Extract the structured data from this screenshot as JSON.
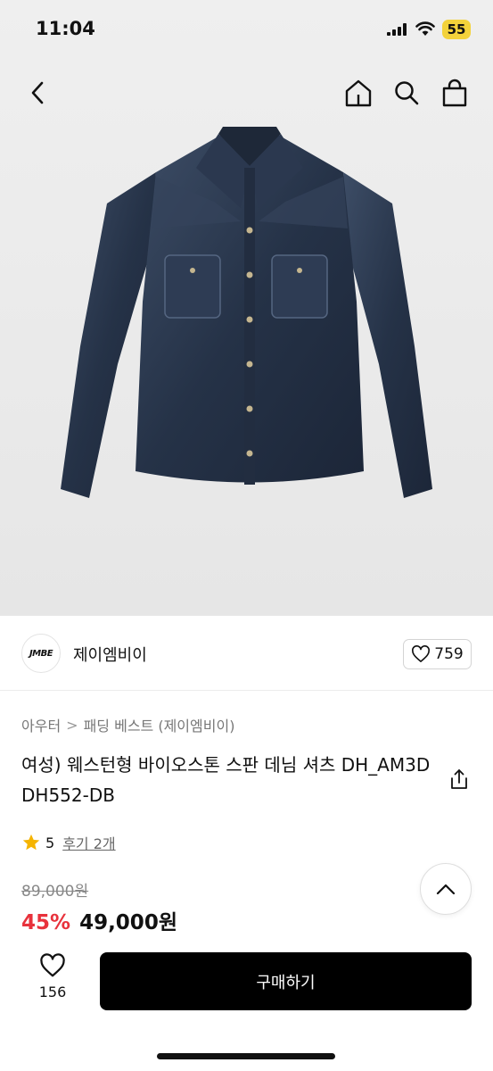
{
  "status_bar": {
    "time": "11:04",
    "battery": "55",
    "icons": [
      "signal-icon",
      "wifi-icon",
      "battery-icon"
    ]
  },
  "nav": {
    "icons": [
      "back-icon",
      "home-icon",
      "search-icon",
      "cart-icon"
    ]
  },
  "product_image": {
    "description_icon": "denim-shirt-image"
  },
  "brand": {
    "logo_text": "JMBE",
    "name": "제이엠비이",
    "likes": "759"
  },
  "breadcrumb": {
    "category": "아우터",
    "separator": ">",
    "subcategory": "패딩 베스트 (제이엠비이)"
  },
  "product": {
    "title": "여성) 웨스턴형 바이오스톤 스판 데님 셔츠 DH_AM3DDH552-DB",
    "rating": "5",
    "review_link": "후기 2개",
    "original_price": "89,000원",
    "discount": "45%",
    "sale_price": "49,000원"
  },
  "bottom_bar": {
    "wish_count": "156",
    "buy_label": "구매하기"
  },
  "colors": {
    "accent_red": "#e8323c",
    "star": "#f5b400",
    "buy_button": "#000000"
  }
}
